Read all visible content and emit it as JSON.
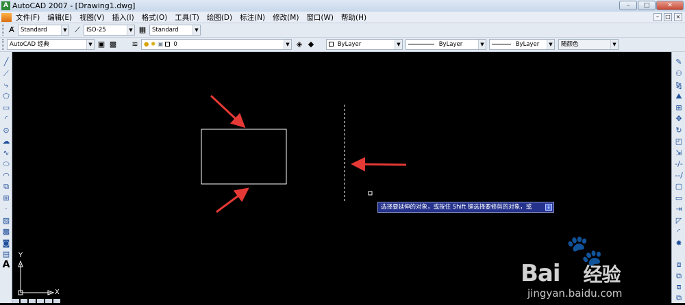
{
  "window": {
    "title": "AutoCAD 2007 - [Drawing1.dwg]",
    "app_icon": "A",
    "controls": [
      "–",
      "□",
      "✕"
    ]
  },
  "menu": {
    "items": [
      "文件(F)",
      "编辑(E)",
      "视图(V)",
      "插入(I)",
      "格式(O)",
      "工具(T)",
      "绘图(D)",
      "标注(N)",
      "修改(M)",
      "窗口(W)",
      "帮助(H)"
    ],
    "mdi_controls": [
      "–",
      "□",
      "×"
    ]
  },
  "styles_toolbar": {
    "text_style": "Standard",
    "dim_style": "ISO-25",
    "table_style": "Standard"
  },
  "workspace_toolbar": {
    "workspace": "AutoCAD 经典",
    "layer": "0",
    "color": "ByLayer",
    "linetype": "ByLayer",
    "lineweight": "ByLayer",
    "plotstyle": "随颜色"
  },
  "command_tooltip": {
    "text": "选择要延伸的对象，或按住 Shift 键选择要修剪的对象，或",
    "button_icon": "expand-arrow-icon"
  },
  "ucs": {
    "x_label": "X",
    "y_label": "Y"
  },
  "watermark": {
    "brand": "Bai",
    "brand_suffix": "经验",
    "url": "jingyan.baidu.com",
    "logo_icon": "paw-icon"
  },
  "colors": {
    "canvas": "#000000",
    "arrow": "#e53935",
    "tooltip_bg": "#26338c",
    "geometry": "#ffffff"
  }
}
